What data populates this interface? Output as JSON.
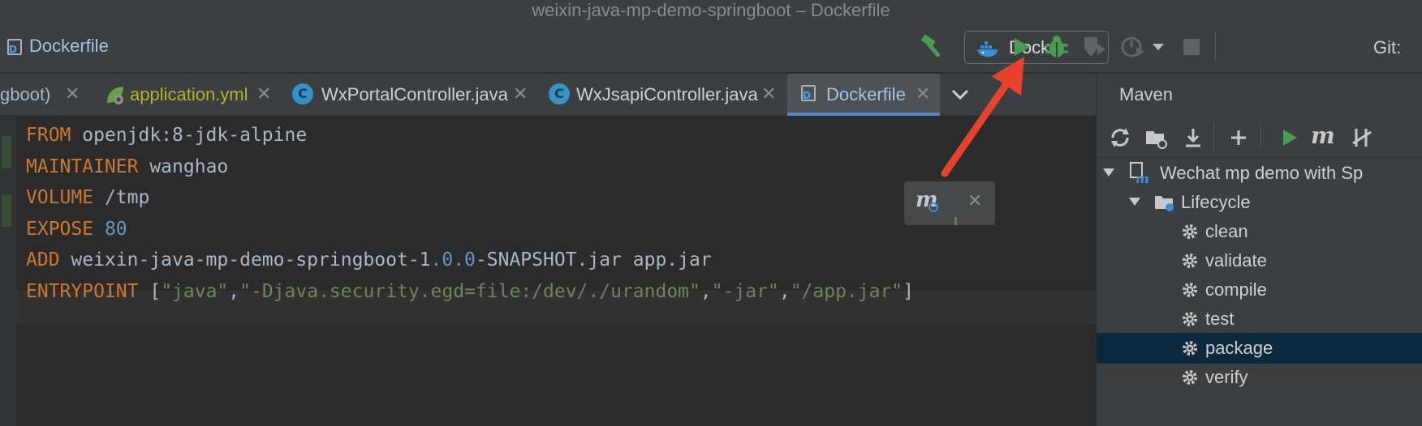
{
  "window": {
    "title": "weixin-java-mp-demo-springboot – Dockerfile"
  },
  "toolbar": {
    "breadcrumb_file": "Dockerfile",
    "run_config": "Docker",
    "git_label": "Git:"
  },
  "tabs": [
    {
      "label": "gboot)",
      "icon": "module-icon",
      "color": "#a9b7c6",
      "active": false
    },
    {
      "label": "application.yml",
      "icon": "spring-leaf-icon",
      "color": "#b8b12e",
      "active": false
    },
    {
      "label": "WxPortalController.java",
      "icon": "class-icon",
      "color": "#cfcfcf",
      "active": false
    },
    {
      "label": "WxJsapiController.java",
      "icon": "class-icon",
      "color": "#cfcfcf",
      "active": false
    },
    {
      "label": "Dockerfile",
      "icon": "dockerfile-icon",
      "color": "#a3c4e3",
      "active": true
    }
  ],
  "editor": {
    "lines": [
      {
        "kw": "FROM",
        "rest": " openjdk:8-jdk-alpine"
      },
      {
        "kw": "MAINTAINER",
        "rest": " wanghao"
      },
      {
        "kw": "VOLUME",
        "rest": " /tmp"
      },
      {
        "kw": "EXPOSE",
        "num": " 80"
      },
      {
        "kw": "ADD",
        "rest": " weixin-java-mp-demo-springboot-1",
        "num": ".0.0",
        "rest2": "-SNAPSHOT.jar app.jar"
      },
      {
        "kw": "ENTRYPOINT",
        "rest": " [",
        "str": "\"java\"",
        "rest2": ",",
        "str2": "\"-Djava.security.egd=file:/dev/./urandom\"",
        "rest3": ",",
        "str3": "\"-jar\"",
        "rest4": ",",
        "str4": "\"/app.jar\"",
        "rest5": "]"
      }
    ]
  },
  "maven": {
    "title": "Maven",
    "project": "Wechat mp demo with Sp",
    "lifecycle": "Lifecycle",
    "goals": [
      "clean",
      "validate",
      "compile",
      "test",
      "package",
      "verify"
    ],
    "selected_goal": "package"
  },
  "colors": {
    "run_green": "#499c54",
    "accent_blue": "#4a88c7",
    "arrow_red": "#e8412c"
  }
}
